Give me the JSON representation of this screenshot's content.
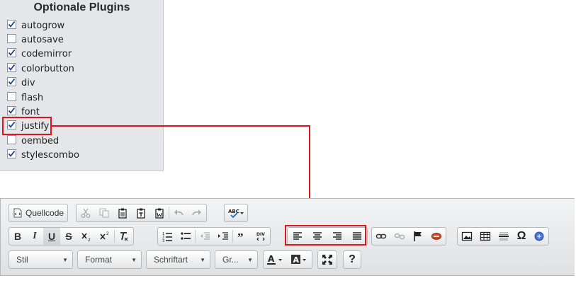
{
  "plugin_panel": {
    "title": "Optionale Plugins",
    "plugins": [
      {
        "label": "autogrow",
        "checked": true
      },
      {
        "label": "autosave",
        "checked": false
      },
      {
        "label": "codemirror",
        "checked": true
      },
      {
        "label": "colorbutton",
        "checked": true
      },
      {
        "label": "div",
        "checked": true
      },
      {
        "label": "flash",
        "checked": false
      },
      {
        "label": "font",
        "checked": true
      },
      {
        "label": "justify",
        "checked": true
      },
      {
        "label": "oembed",
        "checked": false
      },
      {
        "label": "stylescombo",
        "checked": true
      }
    ]
  },
  "toolbar": {
    "source_label": "Quellcode",
    "style_combo": "Stil",
    "format_combo": "Format",
    "font_combo": "Schriftart",
    "size_combo": "Gr...",
    "bold_glyph": "B",
    "italic_glyph": "I",
    "underline_glyph": "U",
    "strike_glyph": "S",
    "omega_glyph": "Ω",
    "help_glyph": "?"
  },
  "colors": {
    "highlight": "#e0141b",
    "panel_bg": "#e4e6e9"
  }
}
